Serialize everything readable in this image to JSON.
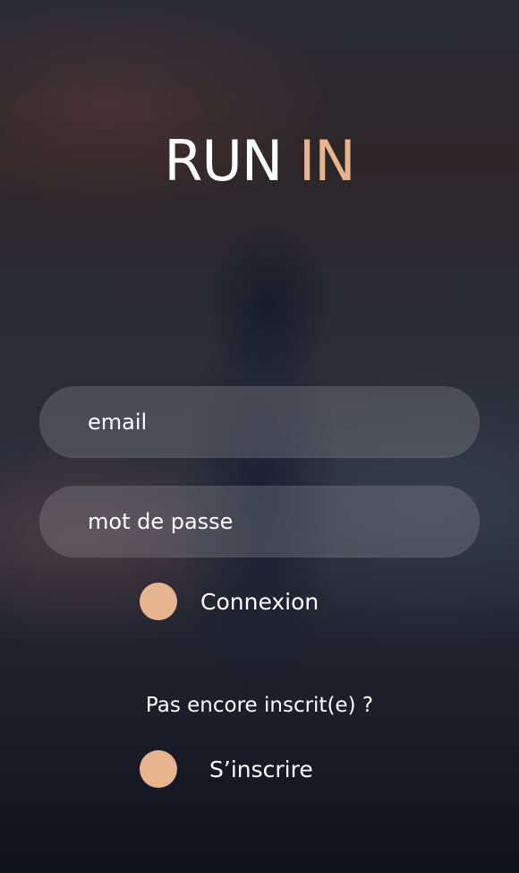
{
  "app": {
    "logo_part1": "RUN",
    "logo_part2": "IN",
    "accent_color": "#e6b48e"
  },
  "login_form": {
    "email_placeholder": "email",
    "password_placeholder": "mot de passe",
    "login_label": "Connexion",
    "login_icon": "circle-bullet-icon"
  },
  "signup": {
    "prompt": "Pas encore inscrit(e) ?",
    "signup_label": "S’inscrire",
    "signup_icon": "circle-bullet-icon"
  }
}
